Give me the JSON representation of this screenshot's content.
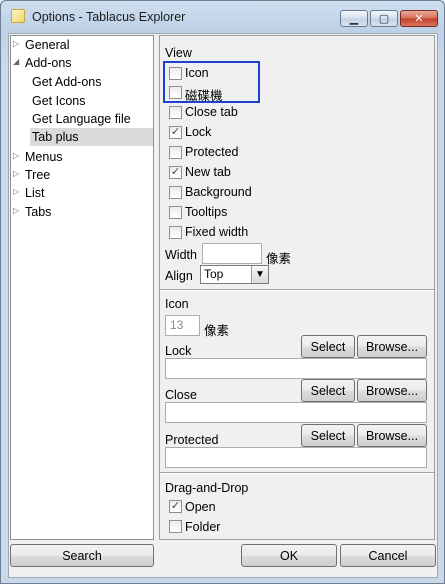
{
  "window": {
    "title": "Options - Tablacus Explorer"
  },
  "tree": {
    "items": [
      {
        "label": "General",
        "level": 0,
        "expander": "collapsed"
      },
      {
        "label": "Add-ons",
        "level": 0,
        "expander": "expanded"
      },
      {
        "label": "Get Add-ons",
        "level": 1
      },
      {
        "label": "Get Icons",
        "level": 1
      },
      {
        "label": "Get Language file",
        "level": 1
      },
      {
        "label": "Tab plus",
        "level": 1,
        "selected": true
      },
      {
        "label": "Menus",
        "level": 0,
        "expander": "collapsed"
      },
      {
        "label": "Tree",
        "level": 0,
        "expander": "collapsed"
      },
      {
        "label": "List",
        "level": 0,
        "expander": "collapsed"
      },
      {
        "label": "Tabs",
        "level": 0,
        "expander": "collapsed"
      }
    ]
  },
  "view": {
    "heading": "View",
    "options": [
      {
        "label": "Icon",
        "checked": false
      },
      {
        "label": "磁碟機",
        "checked": false
      },
      {
        "label": "Close tab",
        "checked": false
      },
      {
        "label": "Lock",
        "checked": true
      },
      {
        "label": "Protected",
        "checked": false
      },
      {
        "label": "New tab",
        "checked": true
      },
      {
        "label": "Background",
        "checked": false
      },
      {
        "label": "Tooltips",
        "checked": false
      },
      {
        "label": "Fixed width",
        "checked": false
      }
    ],
    "width_label": "Width",
    "width_value": "",
    "width_unit": "像素",
    "align_label": "Align",
    "align_value": "Top"
  },
  "icon": {
    "heading": "Icon",
    "size_value": "13",
    "size_unit": "像素",
    "rows": [
      {
        "label": "Lock",
        "select": "Select",
        "browse": "Browse...",
        "value": ""
      },
      {
        "label": "Close",
        "select": "Select",
        "browse": "Browse...",
        "value": ""
      },
      {
        "label": "Protected",
        "select": "Select",
        "browse": "Browse...",
        "value": ""
      }
    ]
  },
  "dragdrop": {
    "heading": "Drag-and-Drop",
    "options": [
      {
        "label": "Open",
        "checked": true
      },
      {
        "label": "Folder",
        "checked": false
      }
    ]
  },
  "footer": {
    "search": "Search",
    "ok": "OK",
    "cancel": "Cancel"
  },
  "colors": {
    "highlight": "#1f3fd0",
    "title_bar": "#bcd0e6",
    "check_mark": "#2a4a7a"
  }
}
